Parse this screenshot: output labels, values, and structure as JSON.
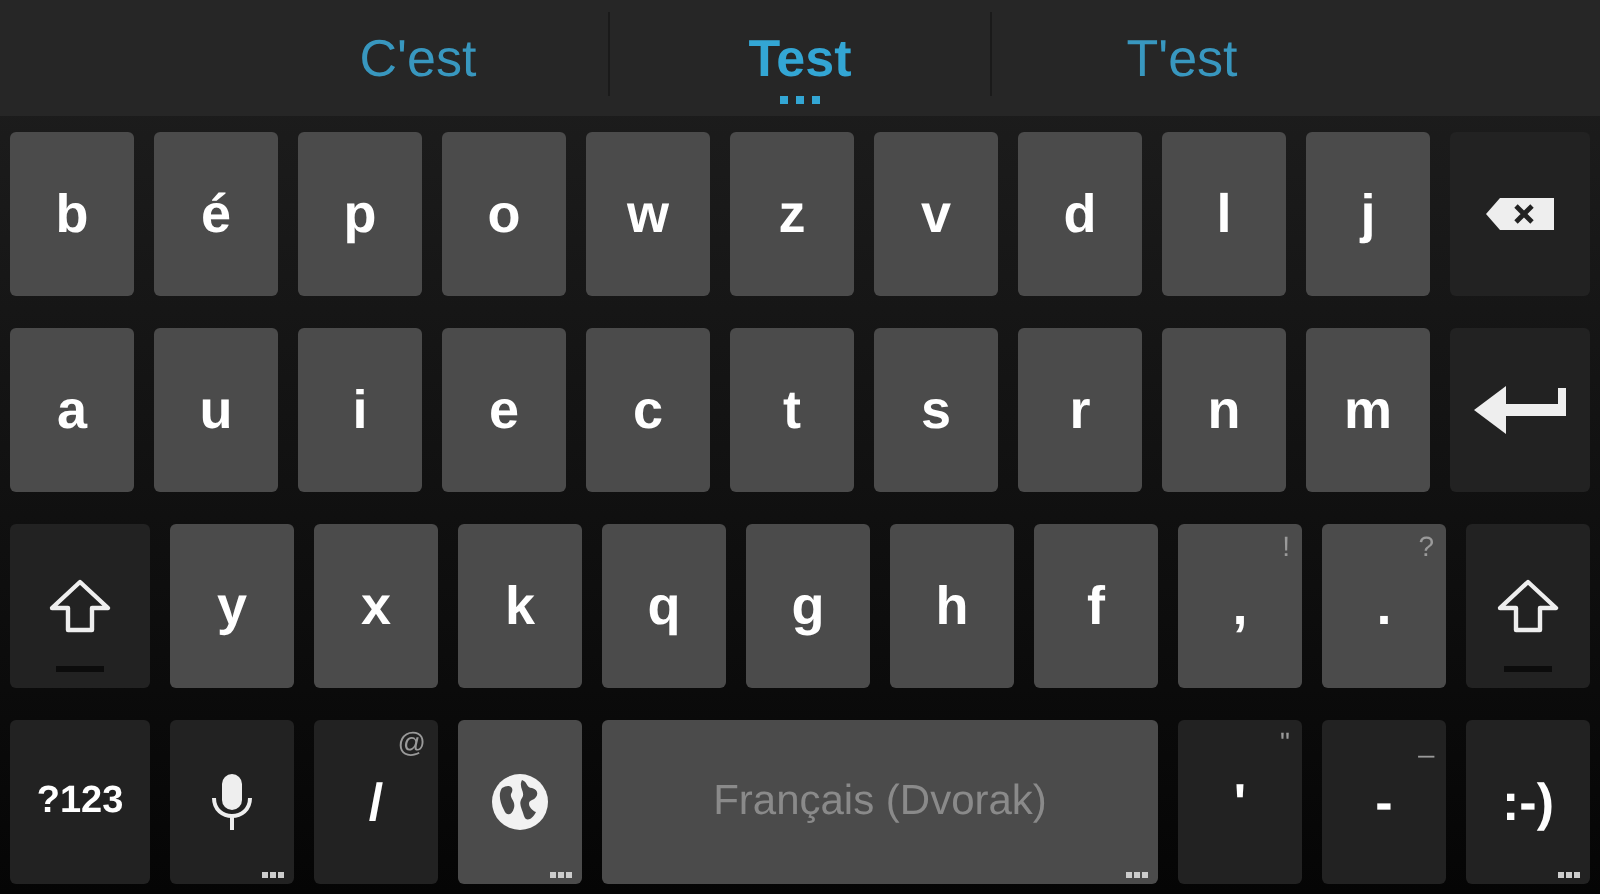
{
  "suggestions": [
    {
      "text": "C'est",
      "selected": false
    },
    {
      "text": "Test",
      "selected": true
    },
    {
      "text": "T'est",
      "selected": false
    }
  ],
  "rows": [
    [
      {
        "kind": "letter",
        "label": "b"
      },
      {
        "kind": "letter",
        "label": "é"
      },
      {
        "kind": "letter",
        "label": "p"
      },
      {
        "kind": "letter",
        "label": "o"
      },
      {
        "kind": "letter",
        "label": "w"
      },
      {
        "kind": "letter",
        "label": "z"
      },
      {
        "kind": "letter",
        "label": "v"
      },
      {
        "kind": "letter",
        "label": "d"
      },
      {
        "kind": "letter",
        "label": "l"
      },
      {
        "kind": "letter",
        "label": "j"
      },
      {
        "kind": "backspace"
      }
    ],
    [
      {
        "kind": "letter",
        "label": "a"
      },
      {
        "kind": "letter",
        "label": "u"
      },
      {
        "kind": "letter",
        "label": "i"
      },
      {
        "kind": "letter",
        "label": "e"
      },
      {
        "kind": "letter",
        "label": "c"
      },
      {
        "kind": "letter",
        "label": "t"
      },
      {
        "kind": "letter",
        "label": "s"
      },
      {
        "kind": "letter",
        "label": "r"
      },
      {
        "kind": "letter",
        "label": "n"
      },
      {
        "kind": "letter",
        "label": "m"
      },
      {
        "kind": "enter"
      }
    ],
    [
      {
        "kind": "shift",
        "on": false
      },
      {
        "kind": "letter",
        "label": "y"
      },
      {
        "kind": "letter",
        "label": "x"
      },
      {
        "kind": "letter",
        "label": "k"
      },
      {
        "kind": "letter",
        "label": "q"
      },
      {
        "kind": "letter",
        "label": "g"
      },
      {
        "kind": "letter",
        "label": "h"
      },
      {
        "kind": "letter",
        "label": "f"
      },
      {
        "kind": "letter",
        "label": ",",
        "hint": "!"
      },
      {
        "kind": "letter",
        "label": ".",
        "hint": "?"
      },
      {
        "kind": "shift",
        "on": false
      }
    ],
    [
      {
        "kind": "symbols",
        "label": "?123"
      },
      {
        "kind": "mic",
        "more": true
      },
      {
        "kind": "symbol",
        "label": "/",
        "hint": "@"
      },
      {
        "kind": "globe",
        "more": true
      },
      {
        "kind": "space",
        "label": "Français (Dvorak)",
        "more": true
      },
      {
        "kind": "symbol",
        "label": "'",
        "hint": "\""
      },
      {
        "kind": "symbol",
        "label": "-",
        "hint": "_"
      },
      {
        "kind": "symbol",
        "label": ":-)",
        "more": true
      }
    ]
  ]
}
